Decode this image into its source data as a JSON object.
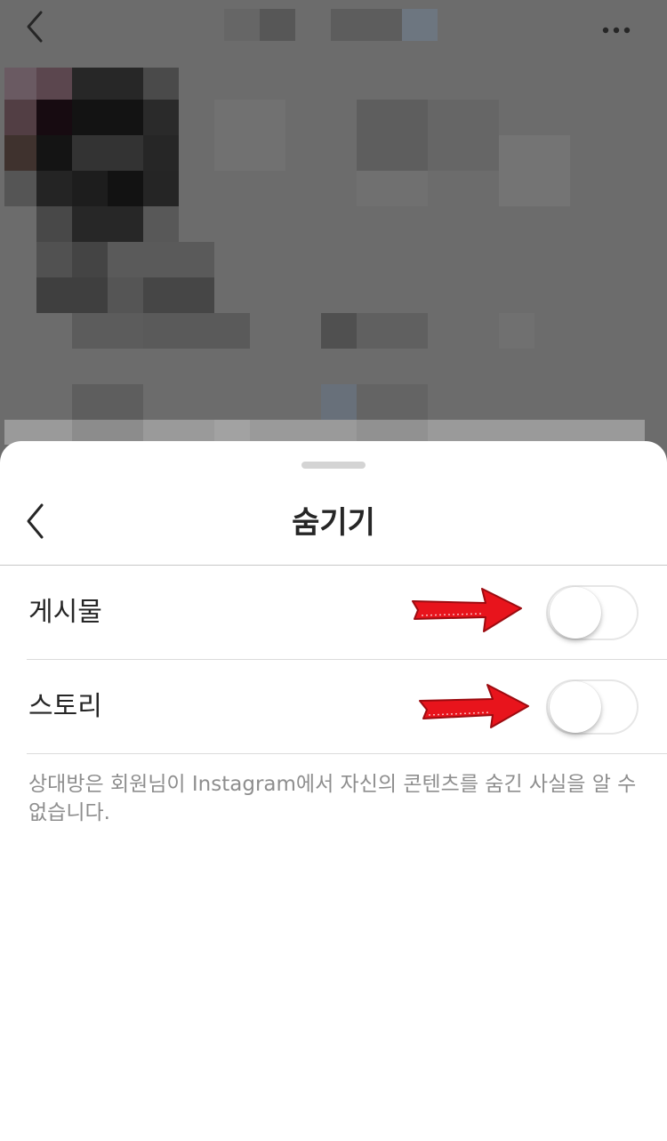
{
  "background": {
    "back_icon": "chevron-left-icon",
    "more_icon": "more-horizontal-icon"
  },
  "sheet": {
    "title": "숨기기",
    "back_icon": "chevron-left-icon"
  },
  "settings": [
    {
      "label": "게시물",
      "enabled": false
    },
    {
      "label": "스토리",
      "enabled": false
    }
  ],
  "annotations": {
    "arrow_color": "#e8141c"
  },
  "note": "상대방은 회원님이 Instagram에서 자신의 콘텐츠를 숨긴 사실을 알 수 없습니다."
}
